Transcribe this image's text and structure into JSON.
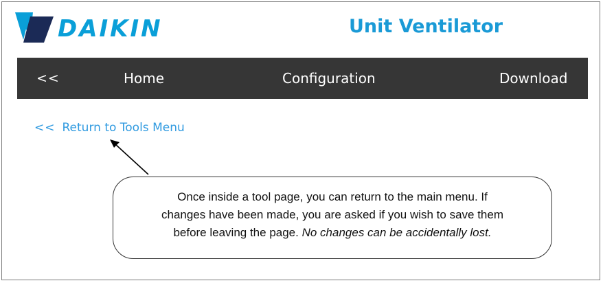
{
  "brand": {
    "logo_text": "DAIKIN",
    "logo_color": "#0a9fd8",
    "logo_mark_color": "#1b2a56"
  },
  "header": {
    "title": "Unit Ventilator",
    "title_color": "#1a9ad6"
  },
  "navbar": {
    "background": "#363636",
    "items": [
      {
        "label": "<<"
      },
      {
        "label": "Home"
      },
      {
        "label": "Configuration"
      },
      {
        "label": "Download"
      }
    ]
  },
  "return_link": {
    "chevron": "<<",
    "label": "Return to Tools Menu",
    "color": "#2f9ae0"
  },
  "callout": {
    "line1": "Once inside a tool page, you can return to the main menu. If",
    "line2": "changes have been made, you are asked if you wish to save them",
    "line3_plain": "before leaving the page.",
    "line3_italic": "No changes can be accidentally lost."
  }
}
